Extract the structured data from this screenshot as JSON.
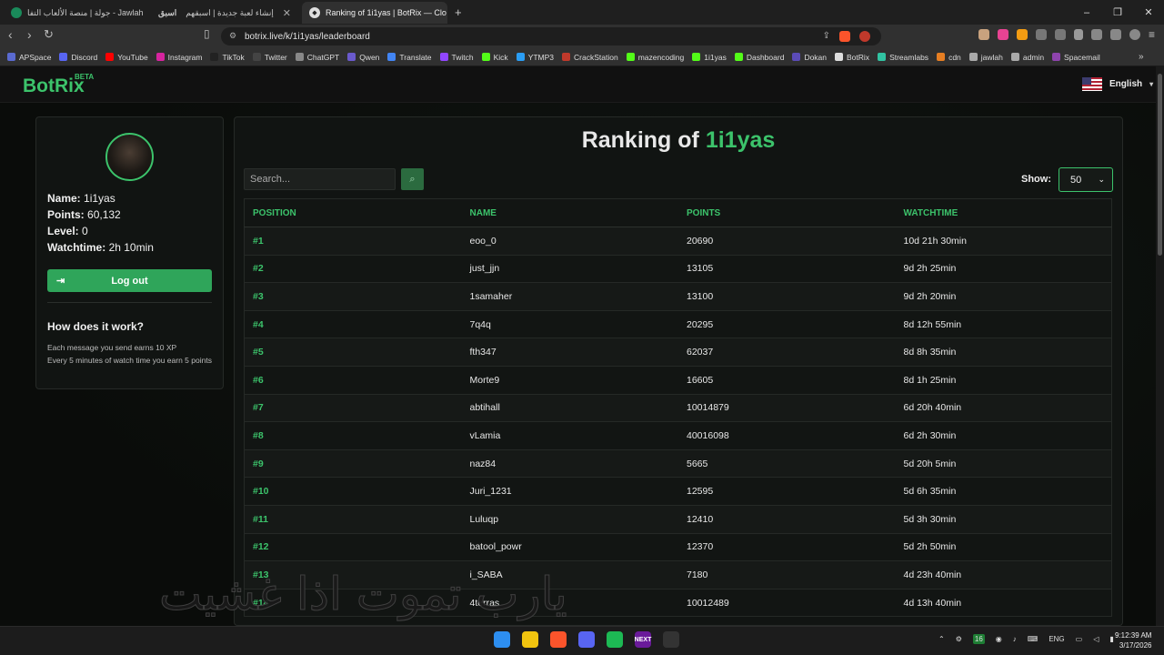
{
  "browser": {
    "tabs": [
      {
        "label": "جولة | منصة الألعاب التفا - Jawlah",
        "prefix": "جوله"
      },
      {
        "label": "إنشاء لعبة جديدة | اسبقهم",
        "prefix": "اسبق"
      },
      {
        "label": "Ranking of 1i1yas | BotRix — Clo"
      }
    ],
    "new_tab": "+",
    "url": "botrix.live/k/1i1yas/leaderboard",
    "window_controls": [
      "–",
      "❐",
      "✕"
    ]
  },
  "bookmarks": [
    {
      "label": "APSpace",
      "color": "#5a6ad0"
    },
    {
      "label": "Discord",
      "color": "#5865f2"
    },
    {
      "label": "YouTube",
      "color": "#ff0000"
    },
    {
      "label": "Instagram",
      "color": "#d6249f"
    },
    {
      "label": "TikTok",
      "color": "#222222"
    },
    {
      "label": "Twitter",
      "color": "#444444"
    },
    {
      "label": "ChatGPT",
      "color": "#888888"
    },
    {
      "label": "Qwen",
      "color": "#6a5acd"
    },
    {
      "label": "Translate",
      "color": "#4285f4"
    },
    {
      "label": "Twitch",
      "color": "#9146ff"
    },
    {
      "label": "Kick",
      "color": "#53fc18"
    },
    {
      "label": "YTMP3",
      "color": "#2a9df4"
    },
    {
      "label": "CrackStation",
      "color": "#c0392b"
    },
    {
      "label": "mazencoding",
      "color": "#53fc18"
    },
    {
      "label": "1i1yas",
      "color": "#53fc18"
    },
    {
      "label": "Dashboard",
      "color": "#53fc18"
    },
    {
      "label": "Dokan",
      "color": "#5b4bb7"
    },
    {
      "label": "BotRix",
      "color": "#dddddd"
    },
    {
      "label": "Streamlabs",
      "color": "#31c3a2"
    },
    {
      "label": "cdn",
      "color": "#e67e22"
    },
    {
      "label": "jawlah",
      "color": "#aaaaaa"
    },
    {
      "label": "admin",
      "color": "#aaaaaa"
    },
    {
      "label": "Spacemail",
      "color": "#8e44ad"
    }
  ],
  "site": {
    "logo": "BotRix",
    "beta": "BETA",
    "language": "English",
    "accent": "#3cc36b"
  },
  "profile": {
    "name_label": "Name:",
    "name": "1i1yas",
    "points_label": "Points:",
    "points": "60,132",
    "level_label": "Level:",
    "level": "0",
    "watchtime_label": "Watchtime:",
    "watchtime": "2h 10min",
    "logout": "Log out",
    "how_title": "How does it work?",
    "how_line1": "Each message you send earns 10 XP",
    "how_line2": "Every 5 minutes of watch time you earn 5 points"
  },
  "leaderboard": {
    "title_prefix": "Ranking of",
    "title_user": "1i1yas",
    "search_placeholder": "Search...",
    "show_label": "Show:",
    "show_value": "50",
    "columns": [
      "POSITION",
      "NAME",
      "POINTS",
      "WATCHTIME"
    ],
    "rows": [
      {
        "pos": "#1",
        "name": "eoo_0",
        "points": "20690",
        "watch": "10d 21h 30min"
      },
      {
        "pos": "#2",
        "name": "just_jjn",
        "points": "13105",
        "watch": "9d 2h 25min"
      },
      {
        "pos": "#3",
        "name": "1samaher",
        "points": "13100",
        "watch": "9d 2h 20min"
      },
      {
        "pos": "#4",
        "name": "7q4q",
        "points": "20295",
        "watch": "8d 12h 55min"
      },
      {
        "pos": "#5",
        "name": "fth347",
        "points": "62037",
        "watch": "8d 8h 35min"
      },
      {
        "pos": "#6",
        "name": "Morte9",
        "points": "16605",
        "watch": "8d 1h 25min"
      },
      {
        "pos": "#7",
        "name": "abtihall",
        "points": "10014879",
        "watch": "6d 20h 40min"
      },
      {
        "pos": "#8",
        "name": "vLamia",
        "points": "40016098",
        "watch": "6d 2h 30min"
      },
      {
        "pos": "#9",
        "name": "naz84",
        "points": "5665",
        "watch": "5d 20h 5min"
      },
      {
        "pos": "#10",
        "name": "Juri_1231",
        "points": "12595",
        "watch": "5d 6h 35min"
      },
      {
        "pos": "#11",
        "name": "Luluqp",
        "points": "12410",
        "watch": "5d 3h 30min"
      },
      {
        "pos": "#12",
        "name": "batool_powr",
        "points": "12370",
        "watch": "5d 2h 50min"
      },
      {
        "pos": "#13",
        "name": "i_SABA",
        "points": "7180",
        "watch": "4d 23h 40min"
      },
      {
        "pos": "#14",
        "name": "4terras",
        "points": "10012489",
        "watch": "4d 13h 40min"
      }
    ]
  },
  "overlay_text": "يارب تموت اذا غشيت",
  "taskbar": {
    "apps": [
      {
        "name": "windows-start-icon",
        "color": "#2d8ef0",
        "label": ""
      },
      {
        "name": "file-explorer-icon",
        "color": "#f1c40f",
        "label": ""
      },
      {
        "name": "brave-icon",
        "color": "#fb542b",
        "label": ""
      },
      {
        "name": "discord-icon",
        "color": "#5865f2",
        "label": ""
      },
      {
        "name": "spotify-icon",
        "color": "#1db954",
        "label": ""
      },
      {
        "name": "next-icon",
        "color": "#6a1b9a",
        "label": "NEXT"
      },
      {
        "name": "steam-icon",
        "color": "#333333",
        "label": ""
      }
    ],
    "lang": "ENG",
    "time": "9:12:39 AM",
    "date": "3/17/2026"
  }
}
